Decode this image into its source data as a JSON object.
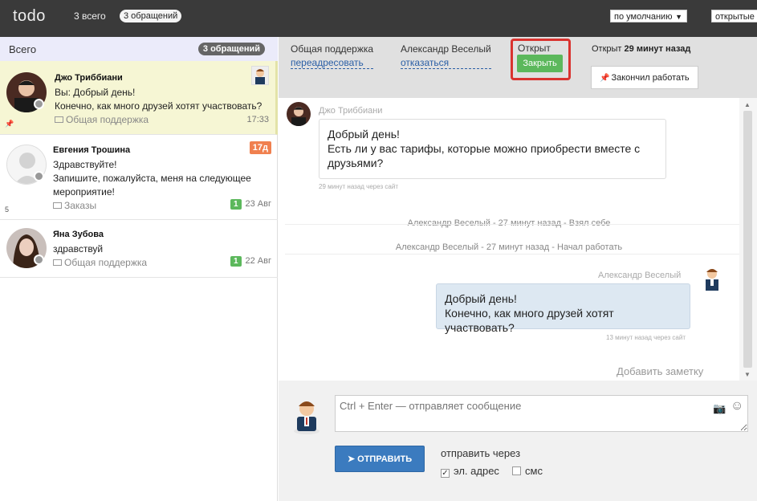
{
  "topbar": {
    "logo": "todo",
    "nav_all": "3 всего",
    "nav_requests": "3 обращений",
    "sort_select": "по умолчанию",
    "status_select": "открытые"
  },
  "sidebar": {
    "title": "Всего",
    "count_badge": "3 обращений",
    "conversations": [
      {
        "name": "Джо Триббиани",
        "line1": "Вы: Добрый день!",
        "line2": "Конечно, как много друзей хотят участвовать?",
        "channel": "Общая поддержка",
        "time": "17:33"
      },
      {
        "name": "Евгения Трошина",
        "line1": "Здравствуйте!",
        "line2": "Запишите, пожалуйста, меня на следующее",
        "line3": "мероприятие!",
        "channel": "Заказы",
        "badge_count": "1",
        "time": "23 Авг",
        "age_badge": "17д",
        "small_count": "5"
      },
      {
        "name": "Яна Зубова",
        "line1": "здравствуй",
        "channel": "Общая поддержка",
        "badge_count": "1",
        "time": "22 Авг"
      }
    ]
  },
  "header": {
    "group_label": "Общая поддержка",
    "group_link": "переадресовать",
    "agent_label": "Александр Веселый",
    "agent_link": "отказаться",
    "status_label": "Открыт",
    "close_button": "Закрыть",
    "opened_prefix": "Открыт",
    "opened_time": "29 минут назад",
    "finish_button": "Закончил работать"
  },
  "chat": {
    "msg1_author": "Джо Триббиани",
    "msg1_line1": "Добрый день!",
    "msg1_line2": "Есть ли у вас тарифы, которые можно приобрести вместе с",
    "msg1_line3": "друзьями?",
    "msg1_meta": "29 минут назад через сайт",
    "event1": "Александр Веселый - 27 минут назад - Взял себе",
    "event2": "Александр Веселый - 27 минут назад - Начал работать",
    "msg2_author": "Александр Веселый",
    "msg2_line1": "Добрый день!",
    "msg2_line2": "Конечно, как много друзей хотят участвовать?",
    "msg2_meta": "13 минут назад через сайт",
    "add_note": "Добавить заметку"
  },
  "compose": {
    "placeholder": "Ctrl + Enter — отправляет сообщение",
    "send_button": "ОТПРАВИТЬ",
    "send_via": "отправить через",
    "option_email": "эл. адрес",
    "option_sms": "смс"
  },
  "colors": {
    "topbar": "#3a3a3a",
    "active_conversation": "#f6f6d4",
    "green": "#5cb85c",
    "orange": "#f0804f",
    "highlight_red": "#d9332f",
    "send_blue": "#3b7bbf"
  }
}
